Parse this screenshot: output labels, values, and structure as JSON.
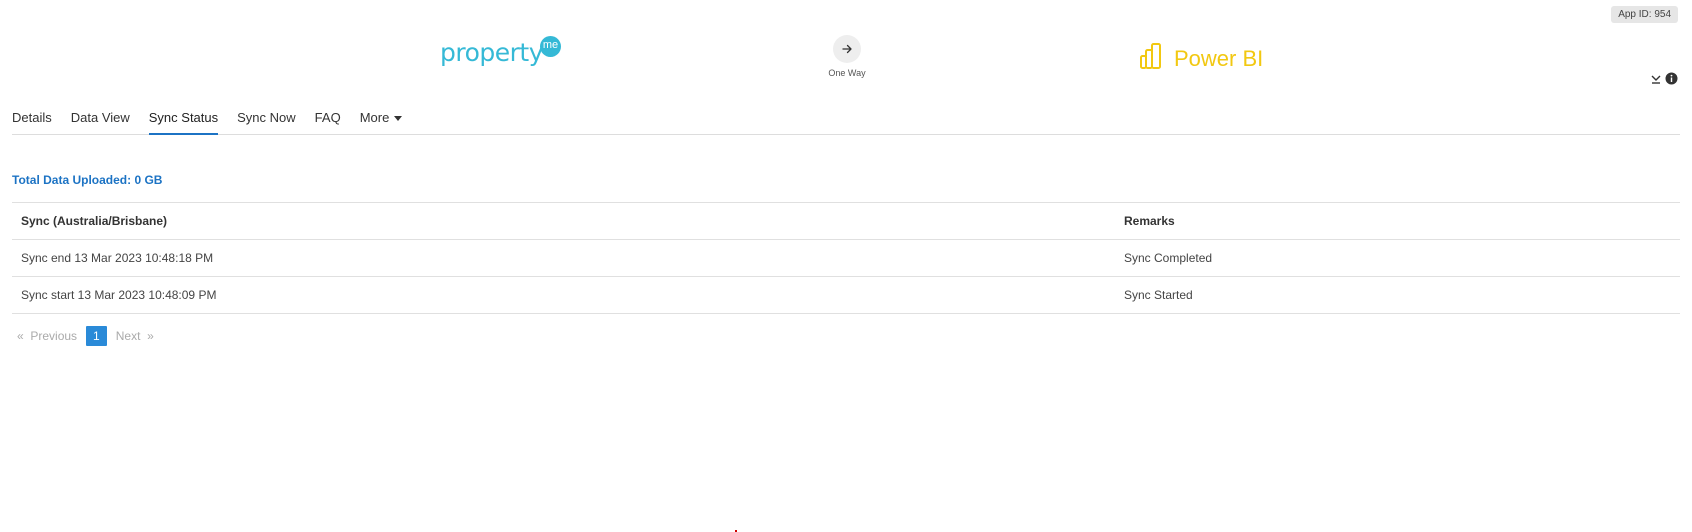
{
  "header": {
    "app_id": "App ID: 954",
    "source_logo": {
      "text": "property",
      "badge": "me"
    },
    "direction": {
      "icon": "arrow-right-icon",
      "label": "One Way"
    },
    "target_logo": {
      "text": "Power BI"
    }
  },
  "tabs": [
    {
      "label": "Details"
    },
    {
      "label": "Data View"
    },
    {
      "label": "Sync Status",
      "active": true
    },
    {
      "label": "Sync Now"
    },
    {
      "label": "FAQ"
    },
    {
      "label": "More"
    }
  ],
  "summary": {
    "total_uploaded": "Total Data Uploaded: 0 GB"
  },
  "table": {
    "columns": [
      "Sync (Australia/Brisbane)",
      "Remarks"
    ],
    "rows": [
      [
        "Sync end 13 Mar 2023 10:48:18 PM",
        "Sync Completed"
      ],
      [
        "Sync start 13 Mar 2023 10:48:09 PM",
        "Sync Started"
      ]
    ]
  },
  "pagination": {
    "prev_symbol": "«",
    "prev_label": "Previous",
    "current_page": "1",
    "next_label": "Next",
    "next_symbol": "»"
  },
  "colors": {
    "accent": "#1c73c4",
    "propertyme": "#35b9d6",
    "powerbi": "#f2c811",
    "page_active": "#2a8ad8"
  }
}
